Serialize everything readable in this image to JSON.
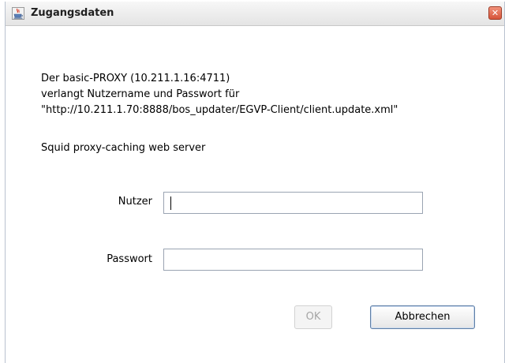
{
  "window": {
    "title": "Zugangsdaten",
    "close_glyph": "✕"
  },
  "message": {
    "line1": "Der basic-PROXY (10.211.1.16:4711)",
    "line2": "verlangt Nutzername und Passwort für",
    "line3": "\"http://10.211.1.70:8888/bos_updater/EGVP-Client/client.update.xml\"",
    "realm": "Squid proxy-caching web server"
  },
  "form": {
    "user_label": "Nutzer",
    "user_value": "",
    "password_label": "Passwort",
    "password_value": ""
  },
  "buttons": {
    "ok_label": "OK",
    "cancel_label": "Abbrechen"
  },
  "icons": {
    "app": "java-cup-icon",
    "close": "close-icon"
  },
  "colors": {
    "close_button": "#d6543a",
    "field_border": "#9aa4b2",
    "default_button_border": "#5f7fa6",
    "disabled_text": "#a5a5a5"
  }
}
